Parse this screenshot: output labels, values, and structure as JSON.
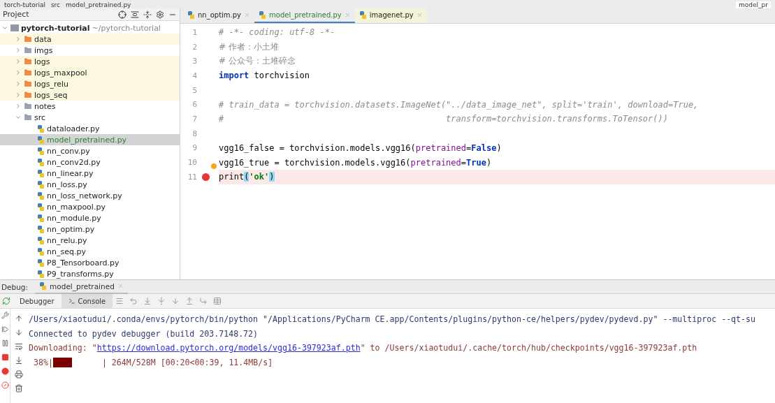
{
  "breadcrumb": [
    "torch-tutorial",
    "src",
    "model_pretrained.py"
  ],
  "run_config": "model_pr",
  "project_panel": {
    "title": "Project",
    "tree": [
      {
        "name": "pytorch-tutorial",
        "hint": "~/pytorch-tutorial",
        "kind": "project",
        "expanded": true,
        "selected": false,
        "excluded": false,
        "children": [
          {
            "name": "data",
            "kind": "folder",
            "expanded": false,
            "selected": false,
            "excluded": true
          },
          {
            "name": "imgs",
            "kind": "folder",
            "expanded": false,
            "selected": false,
            "excluded": false
          },
          {
            "name": "logs",
            "kind": "folder",
            "expanded": false,
            "selected": false,
            "excluded": true
          },
          {
            "name": "logs_maxpool",
            "kind": "folder",
            "expanded": false,
            "selected": false,
            "excluded": true
          },
          {
            "name": "logs_relu",
            "kind": "folder",
            "expanded": false,
            "selected": false,
            "excluded": true
          },
          {
            "name": "logs_seq",
            "kind": "folder",
            "expanded": false,
            "selected": false,
            "excluded": true
          },
          {
            "name": "notes",
            "kind": "folder",
            "expanded": false,
            "selected": false,
            "excluded": false
          },
          {
            "name": "src",
            "kind": "folder",
            "expanded": true,
            "selected": false,
            "excluded": false,
            "children": [
              {
                "name": "dataloader.py",
                "kind": "file",
                "selected": false,
                "excluded": false
              },
              {
                "name": "model_pretrained.py",
                "kind": "file",
                "selected": true,
                "excluded": false
              },
              {
                "name": "nn_conv.py",
                "kind": "file",
                "selected": false,
                "excluded": false
              },
              {
                "name": "nn_conv2d.py",
                "kind": "file",
                "selected": false,
                "excluded": false
              },
              {
                "name": "nn_linear.py",
                "kind": "file",
                "selected": false,
                "excluded": false
              },
              {
                "name": "nn_loss.py",
                "kind": "file",
                "selected": false,
                "excluded": false
              },
              {
                "name": "nn_loss_network.py",
                "kind": "file",
                "selected": false,
                "excluded": false
              },
              {
                "name": "nn_maxpool.py",
                "kind": "file",
                "selected": false,
                "excluded": false
              },
              {
                "name": "nn_module.py",
                "kind": "file",
                "selected": false,
                "excluded": false
              },
              {
                "name": "nn_optim.py",
                "kind": "file",
                "selected": false,
                "excluded": false
              },
              {
                "name": "nn_relu.py",
                "kind": "file",
                "selected": false,
                "excluded": false
              },
              {
                "name": "nn_seq.py",
                "kind": "file",
                "selected": false,
                "excluded": false
              },
              {
                "name": "P8_Tensorboard.py",
                "kind": "file",
                "selected": false,
                "excluded": false
              },
              {
                "name": "P9_transforms.py",
                "kind": "file",
                "selected": false,
                "excluded": false
              }
            ]
          }
        ]
      }
    ]
  },
  "editor": {
    "tabs": [
      {
        "label": "nn_optim.py",
        "selected": false,
        "tinted": false
      },
      {
        "label": "model_pretrained.py",
        "selected": true,
        "tinted": false
      },
      {
        "label": "imagenet.py",
        "selected": false,
        "tinted": true
      }
    ],
    "lines": [
      {
        "number": "1",
        "breakpoint": false,
        "bulb": false,
        "segments": [
          {
            "kind": "comment",
            "text": "# -*- coding: utf-8 -*-"
          }
        ]
      },
      {
        "number": "2",
        "breakpoint": false,
        "bulb": false,
        "segments": [
          {
            "kind": "comment-cjk",
            "text": "# 作者：小土堆"
          }
        ]
      },
      {
        "number": "3",
        "breakpoint": false,
        "bulb": false,
        "segments": [
          {
            "kind": "comment-cjk",
            "text": "# 公众号：土堆碎念"
          }
        ]
      },
      {
        "number": "4",
        "breakpoint": false,
        "bulb": false,
        "segments": [
          {
            "kind": "keyword",
            "text": "import"
          },
          {
            "kind": "plain",
            "text": " torchvision"
          }
        ]
      },
      {
        "number": "5",
        "breakpoint": false,
        "bulb": false
      },
      {
        "number": "6",
        "breakpoint": false,
        "bulb": false,
        "segments": [
          {
            "kind": "comment",
            "text": "# train_data = torchvision.datasets.ImageNet(\"../data_image_net\", split='train', download=True,"
          }
        ]
      },
      {
        "number": "7",
        "breakpoint": false,
        "bulb": false,
        "segments": [
          {
            "kind": "comment",
            "text": "#                                            transform=torchvision.transforms.ToTensor())"
          }
        ]
      },
      {
        "number": "8",
        "breakpoint": false,
        "bulb": false
      },
      {
        "number": "9",
        "breakpoint": false,
        "bulb": false,
        "segments": [
          {
            "kind": "plain",
            "text": "vgg16_false = torchvision.models.vgg16("
          },
          {
            "kind": "param",
            "text": "pretrained"
          },
          {
            "kind": "plain",
            "text": "="
          },
          {
            "kind": "constant",
            "text": "False"
          },
          {
            "kind": "plain",
            "text": ")"
          }
        ]
      },
      {
        "number": "10",
        "breakpoint": false,
        "bulb": true,
        "segments": [
          {
            "kind": "plain",
            "text": "vgg16_true = torchvision.models.vgg16("
          },
          {
            "kind": "param",
            "text": "pretrained"
          },
          {
            "kind": "plain",
            "text": "="
          },
          {
            "kind": "constant",
            "text": "True"
          },
          {
            "kind": "plain",
            "text": ")"
          }
        ]
      },
      {
        "number": "11",
        "breakpoint": true,
        "bulb": false,
        "segments": [
          {
            "kind": "plain",
            "text": "print"
          },
          {
            "kind": "brace",
            "text": "("
          },
          {
            "kind": "string",
            "text": "'ok'"
          },
          {
            "kind": "brace",
            "text": ")"
          }
        ]
      }
    ]
  },
  "debug": {
    "label": "Debug:",
    "session": "model_pretrained",
    "tabs": [
      {
        "label": "Debugger",
        "selected": false
      },
      {
        "label": "Console",
        "selected": true
      }
    ],
    "console": [
      {
        "kind": "stdout",
        "segments": [
          {
            "kind": "text",
            "text": "/Users/xiaotudui/.conda/envs/pytorch/bin/python \"/Applications/PyCharm CE.app/Contents/plugins/python-ce/helpers/pydev/pydevd.py\" --multiproc --qt-su"
          }
        ]
      },
      {
        "kind": "stdout",
        "segments": [
          {
            "kind": "text",
            "text": "Connected to pydev debugger (build 203.7148.72)"
          }
        ]
      },
      {
        "kind": "stderr",
        "segments": [
          {
            "kind": "text",
            "text": "Downloading: \""
          },
          {
            "kind": "link",
            "text": "https://download.pytorch.org/models/vgg16-397923af.pth"
          },
          {
            "kind": "text",
            "text": "\" to /Users/xiaotudui/.cache/torch/hub/checkpoints/vgg16-397923af.pth"
          }
        ]
      },
      {
        "kind": "stderr",
        "segments": [
          {
            "kind": "text",
            "text": " 38%|"
          },
          {
            "kind": "bar"
          },
          {
            "kind": "text",
            "text": "| 264M/528M [00:20<00:39, 11.4MB/s]"
          }
        ]
      }
    ]
  }
}
